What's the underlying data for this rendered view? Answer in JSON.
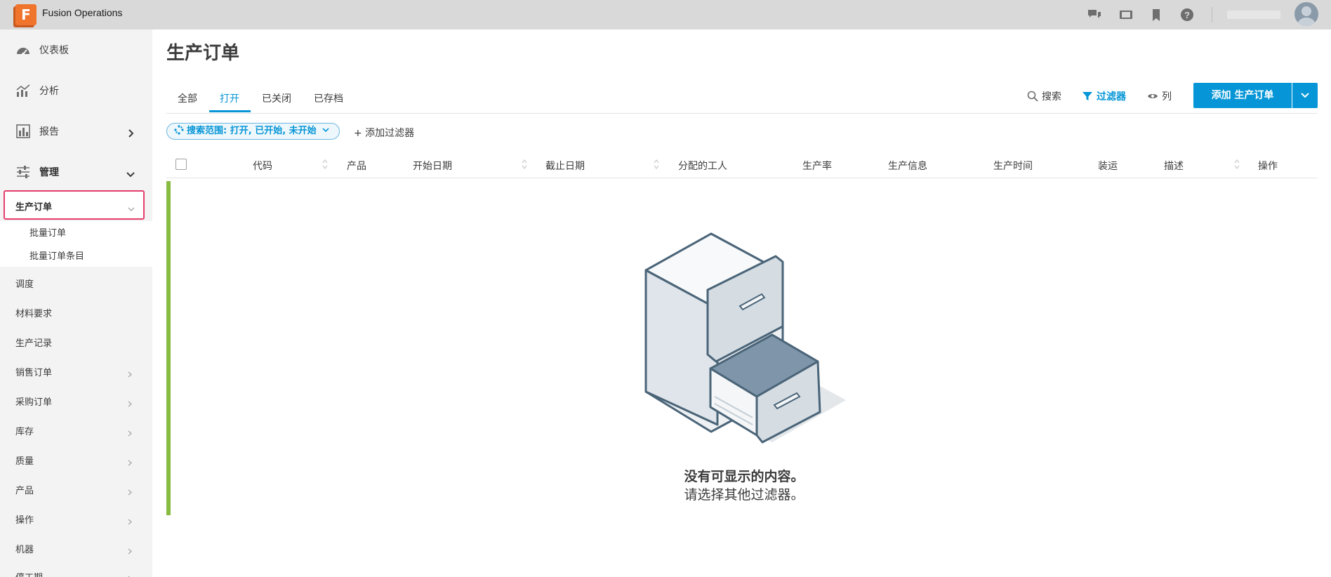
{
  "app": {
    "logo_letter": "F",
    "title": "Fusion Operations"
  },
  "topbar": {
    "icons": [
      "chat-icon",
      "video-icon",
      "bookmark-icon",
      "help-icon"
    ]
  },
  "sidebar": {
    "dashboard": "仪表板",
    "analysis": "分析",
    "reports": "报告",
    "management": "管理",
    "active_item": "生产订单",
    "sub_items": [
      "批量订单",
      "批量订单条目"
    ],
    "items": [
      "调度",
      "材料要求",
      "生产记录",
      "销售订单",
      "采购订单",
      "库存",
      "质量",
      "产品",
      "操作",
      "机器",
      "停工期"
    ]
  },
  "main": {
    "page_title": "生产订单",
    "tabs": [
      "全部",
      "打开",
      "已关闭",
      "已存档"
    ],
    "active_tab": "打开",
    "toolbar": {
      "search": "搜索",
      "filter": "过滤器",
      "columns": "列",
      "add_button": "添加 生产订单"
    },
    "filter_chip": "搜索范围: 打开, 已开始, 未开始",
    "add_filter": "+ 添加过滤器",
    "columns": [
      "代码",
      "产品",
      "开始日期",
      "截止日期",
      "分配的工人",
      "生产率",
      "生产信息",
      "生产时间",
      "装运",
      "描述",
      "操作"
    ],
    "empty_title": "没有可显示的内容。",
    "empty_subtitle": "请选择其他过滤器。"
  },
  "colors": {
    "accent": "#0696d7",
    "active_outline": "#e63d6c",
    "status_bar": "#87bc40",
    "logo": "#f0742c"
  }
}
